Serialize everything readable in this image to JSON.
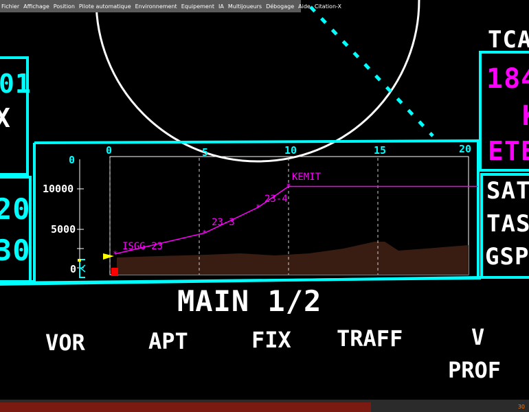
{
  "menubar": {
    "items": [
      "Fichier",
      "Affichage",
      "Position",
      "Pilote automatique",
      "Environnement",
      "Equipement",
      "IA",
      "Multijoueurs",
      "Débogage",
      "Aide",
      "Citation-X"
    ]
  },
  "left_panel": {
    "top_digits": "01",
    "top_letter": "X",
    "mid_digits": "20",
    "bot_digits": "30"
  },
  "right_panel": {
    "tca_label": "TCA",
    "magenta_value": "184",
    "magenta_letter": "K",
    "ete_label": "ETE",
    "sat_label": "SAT",
    "tas_label": "TAS",
    "gsp_label": "GSP"
  },
  "vertical_profile": {
    "x_ticks": [
      "0",
      "5",
      "10",
      "15",
      "20"
    ],
    "y_ticks": [
      "0",
      "5000",
      "10000"
    ],
    "y_top_label": "0",
    "waypoints": [
      {
        "name": "ISGG-23",
        "dist": 0.3,
        "alt": 1900
      },
      {
        "name": "23-3",
        "dist": 5.3,
        "alt": 4500
      },
      {
        "name": "23-4",
        "dist": 8.3,
        "alt": 7700
      },
      {
        "name": "KEMIT",
        "dist": 10.0,
        "alt": 10300
      }
    ],
    "cruise_alt": 10300
  },
  "page_title": "MAIN 1/2",
  "softkeys": {
    "vor": "VOR",
    "apt": "APT",
    "fix": "FIX",
    "traff": "TRAFF",
    "vprof_v": "V",
    "vprof_prof": "PROF"
  },
  "status": {
    "frame_rate": "30"
  },
  "colors": {
    "cyan": "#00ffff",
    "magenta": "#ff00ff",
    "terrain": "#3a1d12",
    "background": "#000000"
  }
}
